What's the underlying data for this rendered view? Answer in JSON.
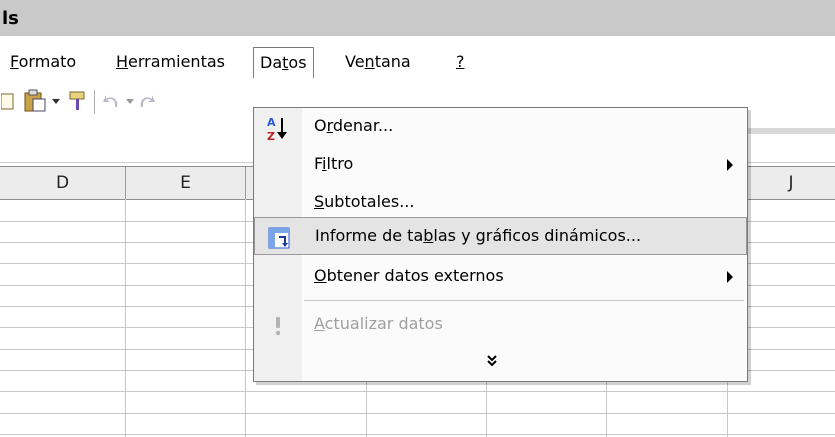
{
  "window": {
    "title": "ls"
  },
  "menubar": {
    "items": [
      {
        "label": "Formato"
      },
      {
        "label": "Herramientas"
      },
      {
        "label": "Datos"
      },
      {
        "label": "Ventana"
      },
      {
        "label": "?"
      }
    ]
  },
  "columns": [
    "D",
    "E",
    "J"
  ],
  "datos_menu": {
    "items": [
      {
        "label": "Ordenar...",
        "icon": "sort-az-icon"
      },
      {
        "label": "Filtro",
        "submenu": true
      },
      {
        "label": "Subtotales..."
      },
      {
        "label": "Informe de tablas y gráficos dinámicos...",
        "icon": "pivot-table-icon",
        "highlighted": true
      },
      {
        "label": "Obtener datos externos",
        "submenu": true
      },
      {
        "label": "Actualizar datos",
        "icon": "refresh-exclamation-icon",
        "disabled": true
      }
    ],
    "expand_icon": "chevron-double-down-icon"
  },
  "colors": {
    "highlight": "#e4e4e4",
    "disabled_text": "#a0a0a0",
    "titlebar": "#c9c9c9"
  }
}
